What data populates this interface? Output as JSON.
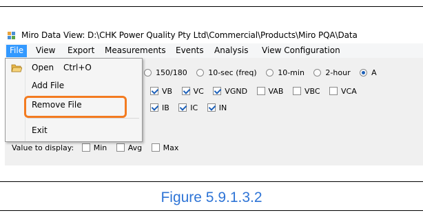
{
  "window": {
    "title": "Miro Data View: D:\\CHK Power Quality Pty Ltd\\Commercial\\Products\\Miro PQA\\Data"
  },
  "menubar": {
    "items": [
      "File",
      "View",
      "Export",
      "Measurements",
      "Events",
      "Analysis",
      "View Configuration"
    ]
  },
  "file_menu": {
    "open_label": "Open",
    "open_shortcut": "Ctrl+O",
    "add_file_label": "Add File",
    "remove_file_label": "Remove File",
    "exit_label": "Exit"
  },
  "interval_options": {
    "items": [
      {
        "label": "150/180",
        "selected": false
      },
      {
        "label": "10-sec (freq)",
        "selected": false
      },
      {
        "label": "10-min",
        "selected": false
      },
      {
        "label": "2-hour",
        "selected": false
      },
      {
        "label": "A",
        "selected": true
      }
    ]
  },
  "voltage_channels": [
    {
      "label": "VB",
      "checked": true
    },
    {
      "label": "VC",
      "checked": true
    },
    {
      "label": "VGND",
      "checked": true
    },
    {
      "label": "VAB",
      "checked": false
    },
    {
      "label": "VBC",
      "checked": false
    },
    {
      "label": "VCA",
      "checked": false
    }
  ],
  "current_channels": [
    {
      "label": "IB",
      "checked": true
    },
    {
      "label": "IC",
      "checked": true
    },
    {
      "label": "IN",
      "checked": true
    }
  ],
  "value_display": {
    "label": "Value to display:",
    "options": [
      {
        "label": "Min",
        "checked": false
      },
      {
        "label": "Avg",
        "checked": false
      },
      {
        "label": "Max",
        "checked": false
      }
    ]
  },
  "caption": "Figure 5.9.1.3.2",
  "colors": {
    "highlight": "#f37b20",
    "menu_active": "#3399ff",
    "caption": "#2e74d6"
  }
}
